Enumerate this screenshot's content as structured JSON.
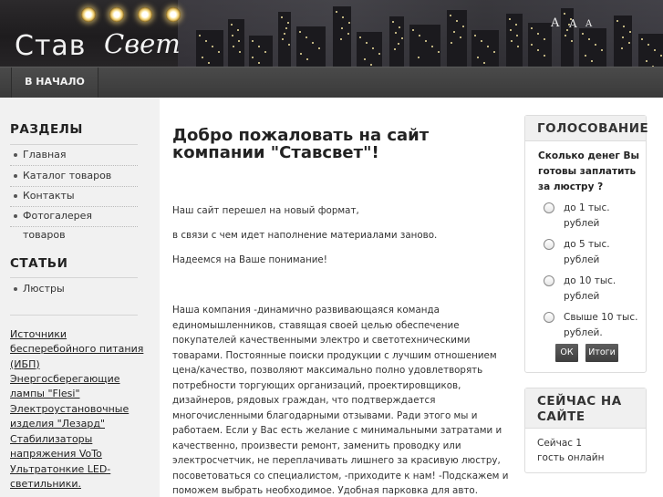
{
  "header": {
    "logo": {
      "part1": "Став",
      "part2": "Свет"
    },
    "font_sizer": [
      "A",
      "A",
      "A"
    ]
  },
  "nav": {
    "items": [
      {
        "label": "В НАЧАЛО"
      }
    ]
  },
  "sidebar": {
    "sections_title": "РАЗДЕЛЫ",
    "sections": [
      "Главная",
      "Каталог товаров",
      "Контакты",
      "Фотогалерея товаров"
    ],
    "articles_title": "СТАТЬИ",
    "articles": [
      "Люстры"
    ],
    "links": [
      "Источники",
      "бесперебойного питания",
      "(ИБП)",
      "Энергосберегающие",
      "лампы \"Flesi\"",
      "Электроустановочные",
      "изделия \"Лезард\"",
      "Стабилизаторы",
      "напряжения VoTo",
      "Ультратонкие LED-",
      "светильники."
    ]
  },
  "main": {
    "title": "Добро пожаловать на сайт компании \"Ставсвет\"!",
    "para1": "Наш сайт перешел на новый формат,",
    "para2": "в связи с чем идет наполнение материалами заново.",
    "para3": "Надеемся на Ваше понимание!",
    "about": "Наша компания -динамично развивающаяся команда единомышленников, ставящая своей целью обеспечение покупателей качественными электро и светотехническими товарами. Постоянные поиски продукции с лучшим отношением цена/качество, позволяют максимально полно удовлетворять потребности торгующих организаций, проектировщиков, дизайнеров, рядовых граждан, что подтверждается многочисленными благодарными отзывами. Ради этого мы и работаем. Если у Вас есть желание с минимальными затратами и качественно, произвести ремонт, заменить проводку или электросчетчик, не переплачивать лишнего за красивую люстру, посоветоваться со специалистом,  -приходите к нам! -Подскажем и поможем выбрать необходимое. Удобная парковка для авто."
  },
  "poll": {
    "title": "ГОЛОСОВАНИЕ",
    "question": "Сколько денег Вы готовы заплатить за люстру ?",
    "options": [
      {
        "line1": "до 1 тыс.",
        "line2": "рублей"
      },
      {
        "line1": "до 5 тыс.",
        "line2": "рублей"
      },
      {
        "line1": "до 10 тыс.",
        "line2": "рублей"
      },
      {
        "line1": "Свыше 10 тыс.",
        "line2": "рублей."
      }
    ],
    "vote_label": "ОК",
    "results_label": "Итоги"
  },
  "online": {
    "title_line1": "СЕЙЧАС НА",
    "title_line2": "САЙТЕ",
    "line1": "Сейчас 1",
    "line2": "гость онлайн"
  }
}
